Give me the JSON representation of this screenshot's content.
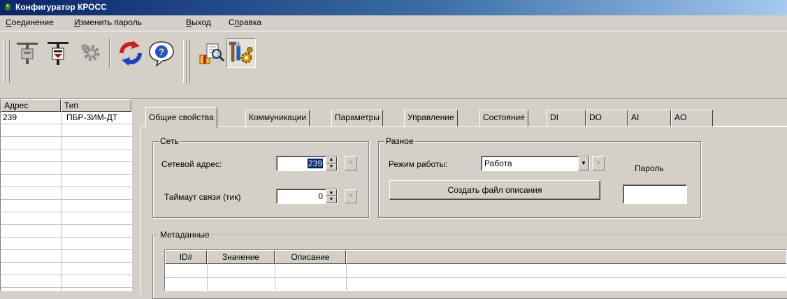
{
  "window": {
    "title": "Конфигуратор КРОСС"
  },
  "menu": {
    "items": [
      {
        "label": "Соединение",
        "accel": "С",
        "rest": "оединение"
      },
      {
        "label": "Изменить пароль",
        "accel": "И",
        "rest": "зменить пароль"
      },
      {
        "label": "Выход",
        "accel": "В",
        "rest": "ыход"
      },
      {
        "label": "Справка",
        "accel": "п",
        "pre": "С",
        "rest": "равка"
      }
    ]
  },
  "toolbar": {
    "buttons": [
      "connect-icon",
      "disconnect-icon",
      "settings-gear-icon",
      "refresh-icon",
      "help-icon",
      "search-package-icon",
      "tools-config-icon"
    ]
  },
  "device_list": {
    "headers": {
      "address": "Адрес",
      "type": "Тип"
    },
    "rows": [
      {
        "address": "239",
        "type": "ПБР-3ИМ-ДТ"
      }
    ]
  },
  "tabs": [
    "Общие свойства",
    "Коммуникации",
    "Параметры",
    "Управление",
    "Состояние",
    "DI",
    "DO",
    "AI",
    "AO"
  ],
  "network": {
    "title": "Сеть",
    "address_label": "Сетевой адрес:",
    "address_value": "239",
    "timeout_label": "Таймаут связи (тик)",
    "timeout_value": "0"
  },
  "misc": {
    "title": "Разное",
    "mode_label": "Режим работы:",
    "mode_value": "Работа",
    "password_label": "Пароль",
    "password_value": "",
    "create_file_button": "Создать файл описания"
  },
  "metadata": {
    "title": "Метаданные",
    "columns": [
      "ID#",
      "Значение",
      "Описание"
    ]
  },
  "colors": {
    "titlebar_start": "#0a246a",
    "face": "#d4d0c8",
    "selection": "#0a246a"
  }
}
